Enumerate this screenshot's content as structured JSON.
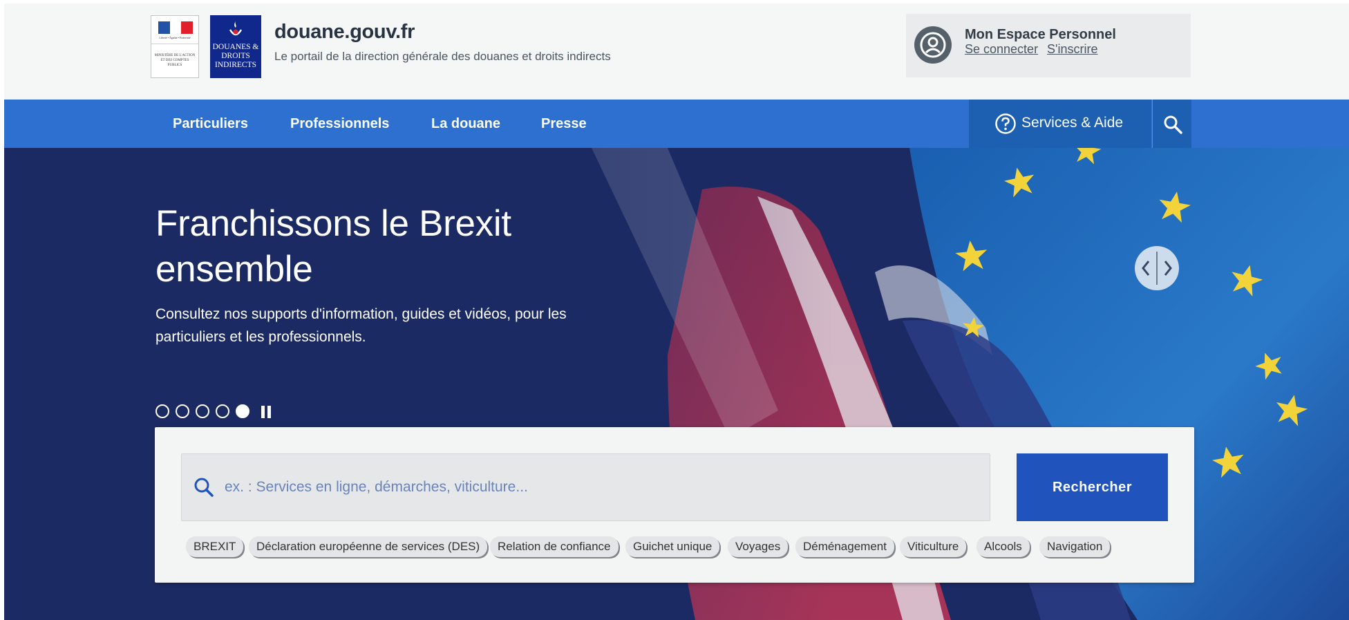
{
  "header": {
    "logo_rf_lines": [
      "Liberté • Égalité • Fraternité",
      "RÉPUBLIQUE FRANÇAISE",
      "MINISTÈRE DE L'ACTION ET DES COMPTES PUBLICS"
    ],
    "logo_dd_text": "DOUANES & DROITS INDIRECTS",
    "site_title": "douane.gouv.fr",
    "site_subtitle": "Le portail de la direction générale des douanes et droits indirects",
    "account": {
      "title": "Mon Espace Personnel",
      "login_label": "Se connecter",
      "signup_label": "S'inscrire"
    }
  },
  "nav": {
    "items": [
      "Particuliers",
      "Professionnels",
      "La douane",
      "Presse"
    ],
    "services_label": "Services & Aide"
  },
  "hero": {
    "title": "Franchissons le Brexit ensemble",
    "description": "Consultez nos supports d'information, guides et vidéos, pour les particuliers et les professionnels.",
    "slides_count": 5,
    "active_slide": 5
  },
  "search": {
    "placeholder": "ex. : Services en ligne, démarches, viticulture...",
    "button_label": "Rechercher",
    "tags": [
      "BREXIT",
      "Déclaration européenne de services (DES)",
      "Relation de confiance",
      "Guichet unique",
      "Voyages",
      "Déménagement",
      "Viticulture",
      "Alcools",
      "Navigation"
    ]
  },
  "colors": {
    "nav_blue": "#2d70d0",
    "services_blue": "#1d5fb1",
    "hero_navy": "#1c2a63",
    "button_blue": "#2054bc"
  }
}
